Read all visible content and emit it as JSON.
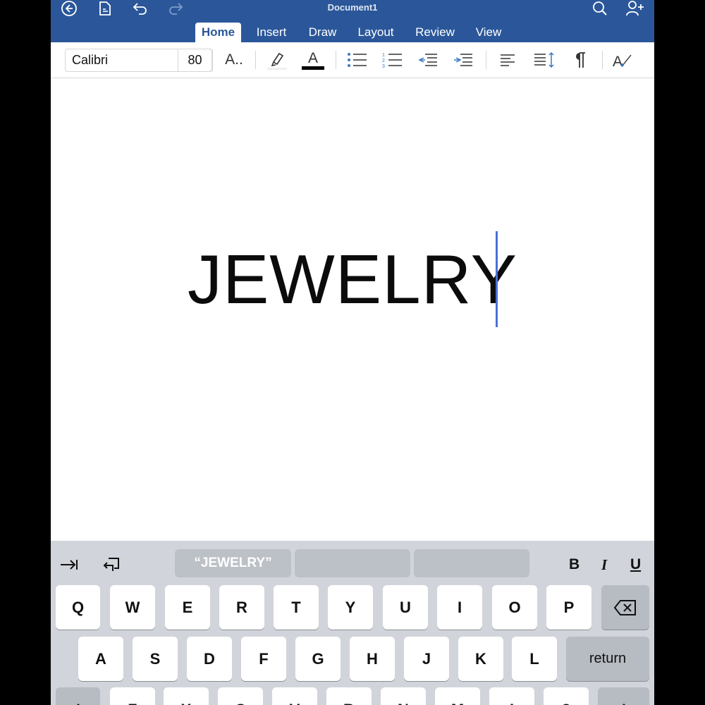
{
  "app": {
    "document_title": "Document1"
  },
  "tabs": [
    "Home",
    "Insert",
    "Draw",
    "Layout",
    "Review",
    "View"
  ],
  "ribbon": {
    "font_name": "Calibri",
    "font_size": "80",
    "text_effects_label": "A..",
    "font_color_letter": "A",
    "font_color": "#000000",
    "accent_color": "#2b579a"
  },
  "document": {
    "body_text": "JEWELRY"
  },
  "keyboard": {
    "suggestions": [
      "“JEWELRY”",
      "",
      ""
    ],
    "format": {
      "bold": "B",
      "italic": "I",
      "underline": "U"
    },
    "row1": [
      "Q",
      "W",
      "E",
      "R",
      "T",
      "Y",
      "U",
      "I",
      "O",
      "P"
    ],
    "row2": [
      "A",
      "S",
      "D",
      "F",
      "G",
      "H",
      "J",
      "K",
      "L"
    ],
    "return_label": "return",
    "row3": [
      "Z",
      "X",
      "C",
      "V",
      "B",
      "N",
      "M",
      "!",
      "?"
    ]
  }
}
